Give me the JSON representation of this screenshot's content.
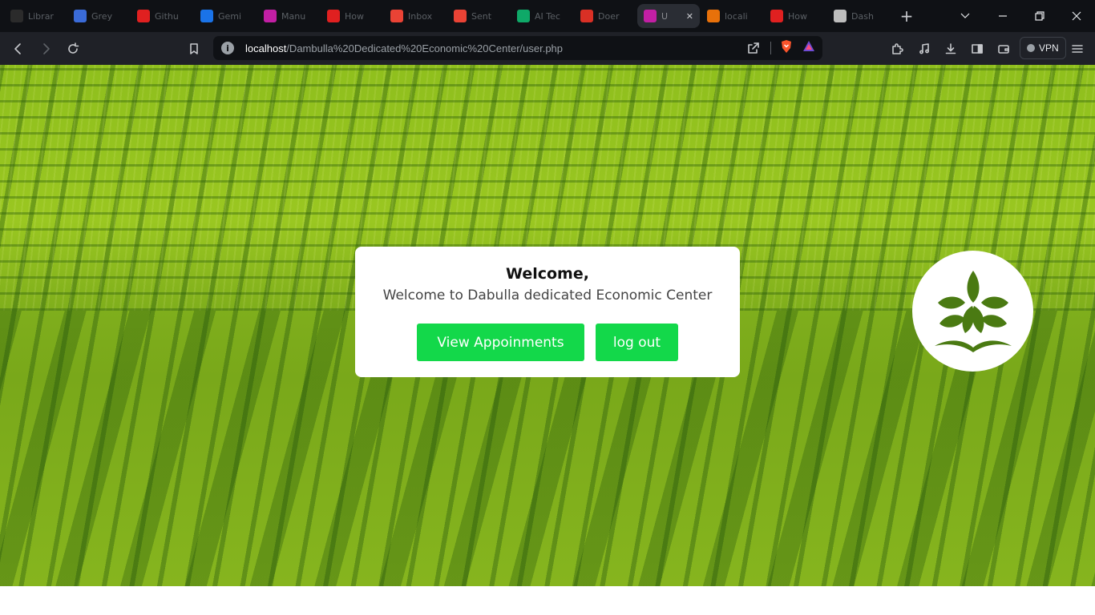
{
  "browser": {
    "tabs": [
      {
        "title": "Librar",
        "color": "#2b2b2b",
        "glyph": "github-icon"
      },
      {
        "title": "Grey",
        "color": "#3a6bd8",
        "glyph": "globe-icon"
      },
      {
        "title": "Githu",
        "color": "#e02020",
        "glyph": "youtube-icon"
      },
      {
        "title": "Gemi",
        "color": "#1a73e8",
        "glyph": "sparkle-icon"
      },
      {
        "title": "Manu",
        "color": "#c21fa4",
        "glyph": "app-icon"
      },
      {
        "title": "How",
        "color": "#e02020",
        "glyph": "youtube-icon"
      },
      {
        "title": "Inbox",
        "color": "#ea4335",
        "glyph": "mail-icon"
      },
      {
        "title": "Sent",
        "color": "#ea4335",
        "glyph": "mail-icon"
      },
      {
        "title": "AI Tec",
        "color": "#0fa968",
        "glyph": "ai-icon"
      },
      {
        "title": "Doer",
        "color": "#d93025",
        "glyph": "doc-icon"
      },
      {
        "title": "U",
        "color": "#c21fa4",
        "glyph": "app-icon",
        "active": true
      },
      {
        "title": "locali",
        "color": "#e8710a",
        "glyph": "chart-icon"
      },
      {
        "title": "How",
        "color": "#e02020",
        "glyph": "youtube-icon"
      },
      {
        "title": "Dash",
        "color": "#bdbdbd",
        "glyph": "doc-icon"
      }
    ],
    "url_host": "localhost",
    "url_path": "/Dambulla%20Dedicated%20Economic%20Center/user.php",
    "vpn_label": "VPN"
  },
  "card": {
    "heading": "Welcome,",
    "message": "Welcome to Dabulla dedicated Economic Center",
    "view_button": "View Appoinments",
    "logout_button": "log out"
  },
  "colors": {
    "accent": "#13d84a",
    "logo_leaf": "#4a7a12"
  }
}
